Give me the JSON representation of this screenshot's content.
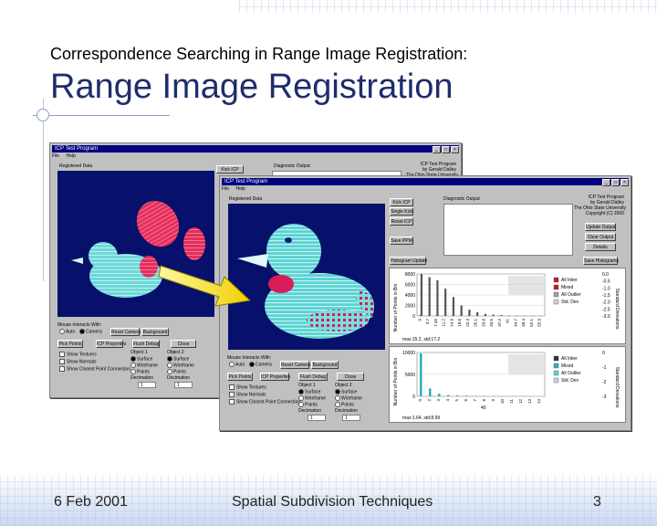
{
  "slide": {
    "subtitle": "Correspondence Searching in Range Image Registration:",
    "title": "Range Image Registration",
    "footer_left": "6 Feb 2001",
    "footer_center": "Spatial Subdivision Techniques",
    "footer_right": "3"
  },
  "window_back": {
    "title": "ICP Test Program",
    "menu_file": "File",
    "menu_help": "Help",
    "registered_label": "Registered Data",
    "diagnostic_label": "Diagnostic Output",
    "kick_button": "Kick ICP",
    "credit1": "ICP Test Program",
    "credit2": "by Gerald Dalley",
    "credit3": "The Ohio State University",
    "mouse_label": "Mouse Interacts With:",
    "radio_auto": "Auto",
    "radio_camera": "Camera",
    "reset_camera": "Reset Camera",
    "background_button": "Background",
    "pick_points": "Pick Points",
    "icp_properties": "ICP Properties",
    "flush_debug": "Flush Debug",
    "close_button": "Close",
    "show_textures": "Show Textures",
    "show_normals": "Show Normals",
    "show_closest": "Show Closest Point Connection",
    "object1": "Object 1",
    "object2": "Object 2",
    "surface": "Surface",
    "wireframe": "Wireframe",
    "points": "Points",
    "decimation": "Decimation",
    "dec1": "1",
    "dec2": "1"
  },
  "window_front": {
    "title": "ICP Test Program",
    "menu_file": "File",
    "menu_help": "Help",
    "registered_label": "Registered Data",
    "diagnostic_label": "Diagnostic Output",
    "kick_icp": "Kick ICP",
    "single_kick": "Single Kick",
    "reset_icp": "Reset ICP",
    "save_ppm": "Save PPM",
    "histogram_update": "Histogram Update",
    "credit1": "ICP Test Program",
    "credit2": "by Gerald Dalley",
    "credit3": "The Ohio State University",
    "credit4": "Copyright (C) 2000",
    "update_output": "Update Output",
    "clear_output": "Clear Output",
    "details": "Details",
    "save_histograms": "Save Histograms",
    "mouse_label": "Mouse Interacts With:",
    "radio_auto": "Auto",
    "radio_camera": "Camera",
    "reset_camera": "Reset Camera",
    "background_button": "Background",
    "pick_points": "Pick Points",
    "icp_properties": "ICP Properties",
    "flush_debug": "Flush Debug",
    "close_button": "Close",
    "show_textures": "Show Textures",
    "show_normals": "Show Normals",
    "show_closest": "Show Closest Point Connection",
    "object1": "Object 1",
    "object2": "Object 2",
    "surface": "Surface",
    "wireframe": "Wireframe",
    "points": "Points",
    "decimation": "Decimation",
    "dec1": "1",
    "dec2": "1",
    "hist1_ylabel": "Number of Points in Bin",
    "hist1_y2label": "Standard Deviations",
    "hist1_caption": "max:15.2, std:17.2",
    "hist1_legend": [
      "All Inlier",
      "Mixed",
      "All Outlier",
      "Std. Dev"
    ],
    "hist1_legend_colors": [
      "#c0201c",
      "#c0201c",
      "#a0a0a0",
      "#d0d0d0"
    ],
    "hist2_ylabel": "Number of Points in Bin",
    "hist2_y2label": "Standard Deviations",
    "hist2_caption": "max:1.64, std:8.99",
    "hist2_legend": [
      "All Inlier",
      "Mixed",
      "All Outlier",
      "Std. Dev"
    ],
    "hist2_legend_colors": [
      "#303030",
      "#2bb0b0",
      "#60d0d0",
      "#d0d0d0"
    ]
  },
  "chart_data": [
    {
      "type": "bar",
      "yticks": [
        "8000",
        "6000",
        "4000",
        "2000",
        "0"
      ],
      "y2ticks": [
        "0.0",
        "-0.5",
        "-1.0",
        "-1.5",
        "-2.0",
        "-2.5",
        "-3.0"
      ],
      "xticks": [
        "0",
        "3.7",
        "7.45",
        "11.2",
        "14.9",
        "18.6",
        "22.3",
        "26.1",
        "29.8",
        "33.5",
        "37.2",
        "41",
        "44.7",
        "48.4",
        "52.1",
        "55.9"
      ],
      "series": [
        {
          "values": [
            180,
            60,
            40,
            30,
            25,
            20,
            18,
            15,
            14,
            12,
            10,
            9,
            8,
            7,
            6,
            5
          ]
        },
        {
          "values": [
            8200,
            7400,
            6800,
            5200,
            3600,
            2000,
            1200,
            700,
            400,
            250,
            150,
            90,
            60,
            40,
            30,
            20
          ]
        }
      ]
    },
    {
      "type": "bar",
      "yticks": [
        "10000",
        "5000",
        "0"
      ],
      "y2ticks": [
        "0",
        "-1",
        "-2",
        "-3"
      ],
      "xticks": [
        "0",
        "2",
        "3",
        "4",
        "5",
        "6",
        "7",
        "8",
        "9",
        "10",
        "11",
        "12",
        "13",
        "14"
      ],
      "xnote": "40",
      "series": [
        {
          "values": [
            9800,
            1800,
            600,
            300,
            200,
            150,
            100,
            80,
            60,
            50,
            40,
            30,
            20,
            10
          ]
        }
      ]
    }
  ]
}
